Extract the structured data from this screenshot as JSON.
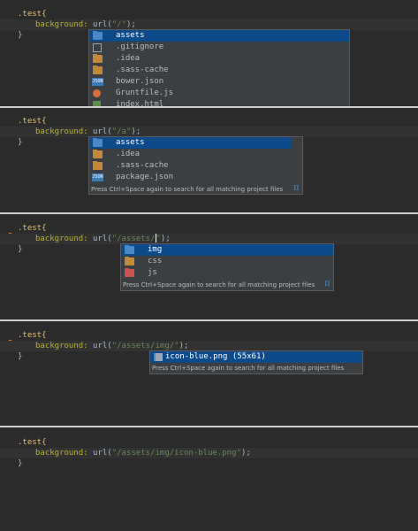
{
  "colors": {
    "selection": "#0d4a8c",
    "popup_bg": "#3c3f41",
    "editor_bg": "#2b2b2b",
    "folder": "#c4883a",
    "folder_blue": "#4a88c7",
    "folder_red": "#c75450"
  },
  "panel1": {
    "line1": ".test{",
    "line2_prop": "background:",
    "line2_fn": "url(",
    "line2_str": "\"/\"",
    "line2_end": ");",
    "line3": "}",
    "items": [
      {
        "icon": "folder-icon",
        "label": "assets"
      },
      {
        "icon": "file-icon",
        "label": ".gitignore"
      },
      {
        "icon": "folder-icon",
        "label": ".idea"
      },
      {
        "icon": "folder-icon",
        "label": ".sass-cache"
      },
      {
        "icon": "json-file-icon",
        "label": "bower.json"
      },
      {
        "icon": "grunt-file-icon",
        "label": "Gruntfile.js"
      },
      {
        "icon": "html-file-icon",
        "label": "index.html"
      }
    ]
  },
  "panel2": {
    "line1": ".test{",
    "line2_prop": "background:",
    "line2_fn": "url(",
    "line2_str": "\"/a\"",
    "line2_end": ");",
    "line3": "}",
    "items": [
      {
        "icon": "folder-icon",
        "label": "assets"
      },
      {
        "icon": "folder-icon",
        "label": ".idea"
      },
      {
        "icon": "folder-icon",
        "label": ".sass-cache"
      },
      {
        "icon": "json-file-icon",
        "label": "package.json"
      }
    ],
    "hint": "Press Ctrl+Space again to search for all matching project files",
    "pi": "π"
  },
  "panel3": {
    "line1": ".test{",
    "line2_prop": "background:",
    "line2_fn": "url(",
    "line2_str": "\"/assets/",
    "line2_str_end": "\"",
    "line2_end": ");",
    "line3": "}",
    "items": [
      {
        "icon": "folder-icon",
        "label": "img"
      },
      {
        "icon": "folder-icon",
        "label": "css"
      },
      {
        "icon": "folder-icon",
        "label": "js"
      }
    ],
    "hint": "Press Ctrl+Space again to search for all matching project files",
    "pi": "π"
  },
  "panel4": {
    "line1": ".test{",
    "line2_prop": "background:",
    "line2_fn": "url(",
    "line2_str": "\"/assets/img/\"",
    "line2_end": ");",
    "line3": "}",
    "items": [
      {
        "icon": "image-file-icon",
        "label": "icon-blue.png  (55x61)"
      }
    ],
    "hint": "Press Ctrl+Space again to search for all matching project files"
  },
  "panel5": {
    "line1": ".test{",
    "line2_prop": "background:",
    "line2_fn": "url(",
    "line2_str": "\"/assets/img/icon-blue.png\"",
    "line2_end": ");",
    "line3": "}"
  }
}
